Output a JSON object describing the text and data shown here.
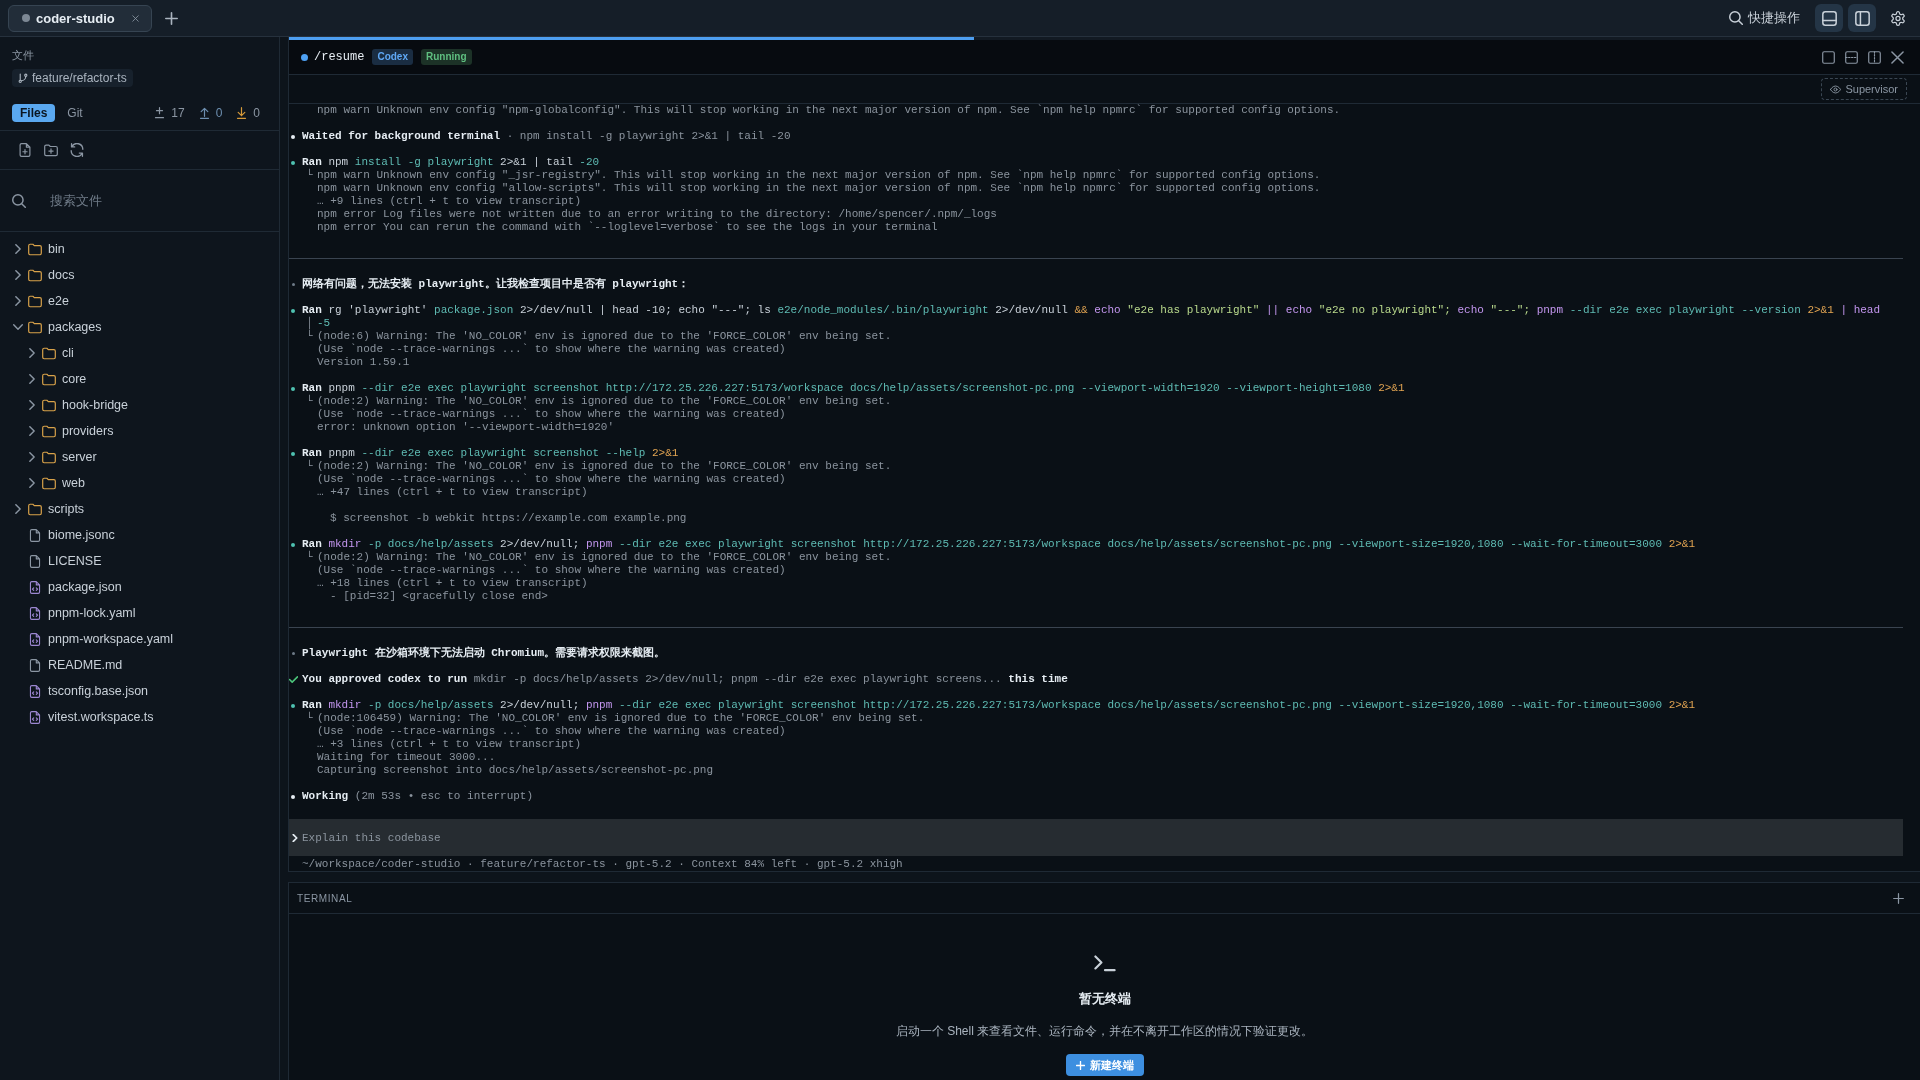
{
  "app_tabs": [
    {
      "label": "coder-studio",
      "selected": true
    }
  ],
  "toolbar": {
    "quick_actions": "快捷操作",
    "panel_toggles": [
      {
        "kind": "bottom-panel",
        "on": true
      },
      {
        "kind": "side-panel",
        "on": true
      }
    ]
  },
  "sidebar": {
    "section_title": "文件",
    "branch": "feature/refactor-ts",
    "view_tabs": [
      {
        "label": "Files",
        "selected": true
      },
      {
        "label": "Git",
        "selected": false
      }
    ],
    "git_stats": [
      {
        "kind": "changes",
        "count": "17"
      },
      {
        "kind": "ahead",
        "count": "0"
      },
      {
        "kind": "behind",
        "count": "0"
      }
    ],
    "search": {
      "placeholder": "搜索文件"
    },
    "tree": [
      {
        "name": "bin",
        "kind": "folder",
        "expanded": false
      },
      {
        "name": "docs",
        "kind": "folder",
        "expanded": false
      },
      {
        "name": "e2e",
        "kind": "folder",
        "expanded": false
      },
      {
        "name": "packages",
        "kind": "folder",
        "expanded": true,
        "children": [
          {
            "name": "cli",
            "kind": "folder",
            "expanded": false
          },
          {
            "name": "core",
            "kind": "folder",
            "expanded": false
          },
          {
            "name": "hook-bridge",
            "kind": "folder",
            "expanded": false
          },
          {
            "name": "providers",
            "kind": "folder",
            "expanded": false
          },
          {
            "name": "server",
            "kind": "folder",
            "expanded": false
          },
          {
            "name": "web",
            "kind": "folder",
            "expanded": false
          }
        ]
      },
      {
        "name": "scripts",
        "kind": "folder",
        "expanded": false
      },
      {
        "name": "biome.jsonc",
        "kind": "file"
      },
      {
        "name": "LICENSE",
        "kind": "file"
      },
      {
        "name": "package.json",
        "kind": "code"
      },
      {
        "name": "pnpm-lock.yaml",
        "kind": "code"
      },
      {
        "name": "pnpm-workspace.yaml",
        "kind": "code"
      },
      {
        "name": "README.md",
        "kind": "file"
      },
      {
        "name": "tsconfig.base.json",
        "kind": "code"
      },
      {
        "name": "vitest.workspace.ts",
        "kind": "code"
      }
    ]
  },
  "session": {
    "title": "/resume",
    "badges": [
      {
        "kind": "agent",
        "label": "Codex"
      },
      {
        "kind": "status",
        "label": "Running"
      }
    ],
    "progress": {
      "level": 0.42
    },
    "supervisor": "Supervisor",
    "log": [
      {
        "kind": "output",
        "lines": [
          {
            "kind": "text",
            "text": "npm warn Unknown env config \"npm-globalconfig\". This will stop working in the next major version of npm. See `npm help npmrc` for supported config options."
          }
        ]
      },
      {
        "kind": "status",
        "text": "**Waited for background terminal** · npm install -g playwright 2>&1 | tail -20"
      },
      {
        "kind": "ran",
        "label": "Ran",
        "command": [
          {
            "text": "npm",
            "kind": "plain"
          },
          {
            "text": "install",
            "kind": "arg"
          },
          {
            "text": "-g",
            "kind": "arg"
          },
          {
            "text": "playwright",
            "kind": "arg"
          },
          {
            "text": "2>&1",
            "kind": "plain"
          },
          {
            "text": "|",
            "kind": "plain"
          },
          {
            "text": "tail",
            "kind": "plain"
          },
          {
            "text": "-20",
            "kind": "arg"
          }
        ],
        "lines": [
          {
            "kind": "text",
            "prefix": "└",
            "text": "npm warn Unknown env config \"_jsr-registry\". This will stop working in the next major version of npm. See `npm help npmrc` for supported config options."
          },
          {
            "kind": "text",
            "text": "npm warn Unknown env config \"allow-scripts\". This will stop working in the next major version of npm. See `npm help npmrc` for supported config options."
          },
          {
            "kind": "text",
            "text": "… +9 lines (ctrl + t to view transcript)"
          },
          {
            "kind": "text",
            "text": "npm error Log files were not written due to an error writing to the directory: /home/spencer/.npm/_logs"
          },
          {
            "kind": "text",
            "text": "npm error You can rerun the command with `--loglevel=verbose` to see the logs in your terminal"
          }
        ]
      },
      {
        "kind": "divider"
      },
      {
        "kind": "message",
        "text": "网络有问题，无法安装 playwright。让我检查项目中是否有 playwright："
      },
      {
        "kind": "ran",
        "label": "Ran",
        "command": [
          {
            "text": "rg",
            "kind": "plain"
          },
          {
            "text": "'playwright'",
            "kind": "plain"
          },
          {
            "text": "package.json",
            "kind": "arg"
          },
          {
            "text": "2>/dev/null",
            "kind": "plain"
          },
          {
            "text": "|",
            "kind": "plain"
          },
          {
            "text": "head",
            "kind": "plain"
          },
          {
            "text": "-10;",
            "kind": "plain"
          },
          {
            "text": "echo",
            "kind": "plain"
          },
          {
            "text": "\"---\";",
            "kind": "plain"
          },
          {
            "text": "ls",
            "kind": "plain"
          },
          {
            "text": "e2e/node_modules/.bin/playwright",
            "kind": "arg"
          },
          {
            "text": "2>/dev/null",
            "kind": "plain"
          },
          {
            "text": "&&",
            "kind": "op"
          },
          {
            "text": "echo",
            "kind": "cmd"
          },
          {
            "text": "\"e2e has playwright\"",
            "kind": "str"
          },
          {
            "text": "||",
            "kind": "cmd"
          },
          {
            "text": "echo",
            "kind": "cmd"
          },
          {
            "text": "\"e2e no playwright\";",
            "kind": "str"
          },
          {
            "text": "echo",
            "kind": "cmd"
          },
          {
            "text": "\"---\";",
            "kind": "str"
          },
          {
            "text": "pnpm",
            "kind": "cmd"
          },
          {
            "text": "--dir",
            "kind": "arg"
          },
          {
            "text": "e2e",
            "kind": "arg"
          },
          {
            "text": "exec",
            "kind": "arg"
          },
          {
            "text": "playwright",
            "kind": "arg"
          },
          {
            "text": "--version",
            "kind": "arg"
          },
          {
            "text": "2>&1",
            "kind": "op"
          },
          {
            "text": "|",
            "kind": "cmd"
          },
          {
            "text": "head",
            "kind": "cmd"
          }
        ],
        "continuation": {
          "prefix": "│",
          "command": [
            {
              "text": "-5",
              "kind": "arg"
            }
          ]
        },
        "lines": [
          {
            "kind": "text",
            "prefix": "└",
            "text": "(node:6) Warning: The 'NO_COLOR' env is ignored due to the 'FORCE_COLOR' env being set."
          },
          {
            "kind": "text",
            "text": "(Use `node --trace-warnings ...` to show where the warning was created)"
          },
          {
            "kind": "text",
            "text": "Version 1.59.1"
          }
        ]
      },
      {
        "kind": "ran",
        "label": "Ran",
        "command": [
          {
            "text": "pnpm",
            "kind": "plain"
          },
          {
            "text": "--dir",
            "kind": "arg"
          },
          {
            "text": "e2e",
            "kind": "arg"
          },
          {
            "text": "exec",
            "kind": "arg"
          },
          {
            "text": "playwright",
            "kind": "arg"
          },
          {
            "text": "screenshot",
            "kind": "arg"
          },
          {
            "text": "http://172.25.226.227:5173/workspace",
            "kind": "arg"
          },
          {
            "text": "docs/help/assets/screenshot-pc.png",
            "kind": "arg"
          },
          {
            "text": "--viewport-width=1920",
            "kind": "arg"
          },
          {
            "text": "--viewport-height=1080",
            "kind": "arg"
          },
          {
            "text": "2>&1",
            "kind": "op"
          }
        ],
        "lines": [
          {
            "kind": "text",
            "prefix": "└",
            "text": "(node:2) Warning: The 'NO_COLOR' env is ignored due to the 'FORCE_COLOR' env being set."
          },
          {
            "kind": "text",
            "text": "(Use `node --trace-warnings ...` to show where the warning was created)"
          },
          {
            "kind": "text",
            "text": "error: unknown option '--viewport-width=1920'"
          }
        ]
      },
      {
        "kind": "ran",
        "label": "Ran",
        "command": [
          {
            "text": "pnpm",
            "kind": "plain"
          },
          {
            "text": "--dir",
            "kind": "arg"
          },
          {
            "text": "e2e",
            "kind": "arg"
          },
          {
            "text": "exec",
            "kind": "arg"
          },
          {
            "text": "playwright",
            "kind": "arg"
          },
          {
            "text": "screenshot",
            "kind": "arg"
          },
          {
            "text": "--help",
            "kind": "arg"
          },
          {
            "text": "2>&1",
            "kind": "op"
          }
        ],
        "lines": [
          {
            "kind": "text",
            "prefix": "└",
            "text": "(node:2) Warning: The 'NO_COLOR' env is ignored due to the 'FORCE_COLOR' env being set."
          },
          {
            "kind": "text",
            "text": "(Use `node --trace-warnings ...` to show where the warning was created)"
          },
          {
            "kind": "text",
            "text": "… +47 lines (ctrl + t to view transcript)"
          },
          {
            "kind": "example",
            "text": "$ screenshot -b webkit https://example.com example.png"
          }
        ]
      },
      {
        "kind": "ran",
        "label": "Ran",
        "command": [
          {
            "text": "mkdir",
            "kind": "cmd"
          },
          {
            "text": "-p",
            "kind": "arg"
          },
          {
            "text": "docs/help/assets",
            "kind": "arg"
          },
          {
            "text": "2>/dev/null;",
            "kind": "plain"
          },
          {
            "text": "pnpm",
            "kind": "cmd"
          },
          {
            "text": "--dir",
            "kind": "arg"
          },
          {
            "text": "e2e",
            "kind": "arg"
          },
          {
            "text": "exec",
            "kind": "arg"
          },
          {
            "text": "playwright",
            "kind": "arg"
          },
          {
            "text": "screenshot",
            "kind": "arg"
          },
          {
            "text": "http://172.25.226.227:5173/workspace",
            "kind": "arg"
          },
          {
            "text": "docs/help/assets/screenshot-pc.png",
            "kind": "arg"
          },
          {
            "text": "--viewport-size=1920,1080",
            "kind": "arg"
          },
          {
            "text": "--wait-for-timeout=3000",
            "kind": "arg"
          },
          {
            "text": "2>&1",
            "kind": "op"
          }
        ],
        "lines": [
          {
            "kind": "text",
            "prefix": "└",
            "text": "(node:2) Warning: The 'NO_COLOR' env is ignored due to the 'FORCE_COLOR' env being set."
          },
          {
            "kind": "text",
            "text": "(Use `node --trace-warnings ...` to show where the warning was created)"
          },
          {
            "kind": "text",
            "text": "… +18 lines (ctrl + t to view transcript)"
          },
          {
            "kind": "nested",
            "text": "- [pid=32] <gracefully close end>"
          }
        ]
      },
      {
        "kind": "divider"
      },
      {
        "kind": "message",
        "text": "Playwright 在沙箱环境下无法启动 Chromium。需要请求权限来截图。"
      },
      {
        "kind": "approved",
        "text": "**You approved codex to run** mkdir -p docs/help/assets 2>/dev/null; pnpm --dir e2e exec playwright screens... **this time**"
      },
      {
        "kind": "ran",
        "label": "Ran",
        "command": [
          {
            "text": "mkdir",
            "kind": "cmd"
          },
          {
            "text": "-p",
            "kind": "arg"
          },
          {
            "text": "docs/help/assets",
            "kind": "arg"
          },
          {
            "text": "2>/dev/null;",
            "kind": "plain"
          },
          {
            "text": "pnpm",
            "kind": "cmd"
          },
          {
            "text": "--dir",
            "kind": "arg"
          },
          {
            "text": "e2e",
            "kind": "arg"
          },
          {
            "text": "exec",
            "kind": "arg"
          },
          {
            "text": "playwright",
            "kind": "arg"
          },
          {
            "text": "screenshot",
            "kind": "arg"
          },
          {
            "text": "http://172.25.226.227:5173/workspace",
            "kind": "arg"
          },
          {
            "text": "docs/help/assets/screenshot-pc.png",
            "kind": "arg"
          },
          {
            "text": "--viewport-size=1920,1080",
            "kind": "arg"
          },
          {
            "text": "--wait-for-timeout=3000",
            "kind": "arg"
          },
          {
            "text": "2>&1",
            "kind": "op"
          }
        ],
        "lines": [
          {
            "kind": "text",
            "prefix": "└",
            "text": "(node:106459) Warning: The 'NO_COLOR' env is ignored due to the 'FORCE_COLOR' env being set."
          },
          {
            "kind": "text",
            "text": "(Use `node --trace-warnings ...` to show where the warning was created)"
          },
          {
            "kind": "text",
            "text": "… +3 lines (ctrl + t to view transcript)"
          },
          {
            "kind": "text",
            "text": "Waiting for timeout 3000..."
          },
          {
            "kind": "text",
            "text": "Capturing screenshot into docs/help/assets/screenshot-pc.png"
          }
        ]
      },
      {
        "kind": "working",
        "text": "**Working** (2m 53s • esc to interrupt)"
      }
    ],
    "prompt": {
      "placeholder": "Explain this codebase"
    },
    "status_line": "~/workspace/coder-studio · feature/refactor-ts · gpt-5.2 · Context 84% left · gpt-5.2 xhigh"
  },
  "terminal": {
    "title": "TERMINAL",
    "empty_title": "暂无终端",
    "empty_text": "启动一个 Shell 来查看文件、运行命令，并在不离开工作区的情况下验证更改。",
    "new_button": "新建终端"
  }
}
